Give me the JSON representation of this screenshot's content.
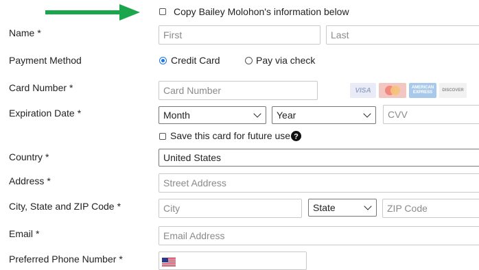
{
  "copy_info": {
    "label": "Copy Bailey Molohon's information below",
    "checked": false
  },
  "name": {
    "label": "Name",
    "required_mark": "*",
    "first_placeholder": "First",
    "last_placeholder": "Last"
  },
  "payment_method": {
    "label": "Payment Method",
    "options": [
      {
        "label": "Credit Card",
        "selected": true
      },
      {
        "label": "Pay via check",
        "selected": false
      }
    ]
  },
  "card_number": {
    "label": "Card Number",
    "required_mark": "*",
    "placeholder": "Card Number",
    "brands": [
      "VISA",
      "MasterCard",
      "AMERICAN EXPRESS",
      "DISCOVER"
    ]
  },
  "expiration": {
    "label": "Expiration Date",
    "required_mark": "*",
    "month_value": "Month",
    "year_value": "Year",
    "cvv_placeholder": "CVV"
  },
  "save_card": {
    "label": "Save this card for future use",
    "checked": false,
    "help_icon": "question-circle-icon"
  },
  "country": {
    "label": "Country",
    "required_mark": "*",
    "value": "United States"
  },
  "address": {
    "label": "Address",
    "required_mark": "*",
    "placeholder": "Street Address"
  },
  "city_state_zip": {
    "label": "City, State and ZIP Code",
    "required_mark": "*",
    "city_placeholder": "City",
    "state_value": "State",
    "zip_placeholder": "ZIP Code"
  },
  "email": {
    "label": "Email",
    "required_mark": "*",
    "placeholder": "Email Address"
  },
  "phone": {
    "label": "Preferred Phone Number",
    "required_mark": "*",
    "flag_icon": "us-flag-icon"
  },
  "colors": {
    "arrow": "#1aa64a",
    "radio_accent": "#1a73e8"
  }
}
